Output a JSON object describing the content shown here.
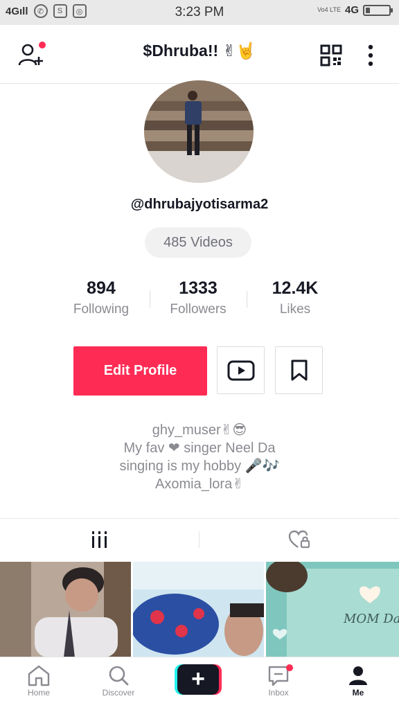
{
  "status_bar": {
    "network_left": "4G",
    "signal_bars": "ıll",
    "time": "3:23 PM",
    "network_right": "4G",
    "lte_label": "Vo4 LTE",
    "icons": [
      "whatsapp-icon",
      "s-app-icon",
      "instagram-icon",
      "battery-icon"
    ]
  },
  "header": {
    "title": "$Dhruba!!",
    "title_emoji": "✌🤘"
  },
  "profile": {
    "username": "@dhrubajyotisarma2",
    "videos_count_label": "485 Videos",
    "stats": [
      {
        "value": "894",
        "label": "Following"
      },
      {
        "value": "1333",
        "label": "Followers"
      },
      {
        "value": "12.4K",
        "label": "Likes"
      }
    ],
    "edit_profile_label": "Edit Profile",
    "bio_lines": [
      "ghy_muser✌😎",
      "My fav ❤ singer Neel Da",
      "singing is my hobby 🎤🎶",
      "Axomia_lora✌"
    ]
  },
  "thumbnails": [
    {
      "overlay_text": ""
    },
    {
      "overlay_text": ""
    },
    {
      "overlay_text": "MOM Dad"
    }
  ],
  "bottom_nav": {
    "items": [
      {
        "label": "Home",
        "icon": "home-icon"
      },
      {
        "label": "Discover",
        "icon": "search-icon"
      },
      {
        "label": "",
        "icon": "plus-icon"
      },
      {
        "label": "Inbox",
        "icon": "inbox-icon"
      },
      {
        "label": "Me",
        "icon": "person-icon"
      }
    ]
  },
  "colors": {
    "accent": "#fe2c55",
    "cyan": "#25f4ee",
    "text_primary": "#161823",
    "text_secondary": "#8a8b91"
  }
}
